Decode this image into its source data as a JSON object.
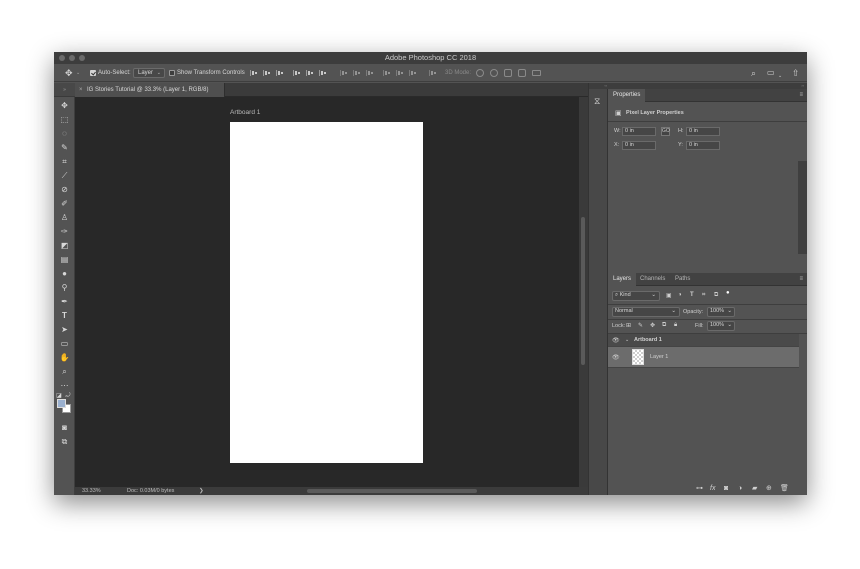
{
  "window": {
    "title": "Adobe Photoshop CC 2018"
  },
  "options_bar": {
    "auto_select_label": "Auto-Select:",
    "auto_select_target": "Layer",
    "show_transform_label": "Show Transform Controls",
    "mode_3d_label": "3D Mode:"
  },
  "document": {
    "tab_title": "IG Stories Tutorial @ 33.3% (Layer 1, RGB/8)",
    "artboard_label": "Artboard 1"
  },
  "status_bar": {
    "zoom": "33.33%",
    "doc_size": "Doc: 0.03M/0 bytes",
    "arrow": "❯"
  },
  "properties_panel": {
    "tab": "Properties",
    "section_title": "Pixel Layer Properties",
    "fields": {
      "w_label": "W:",
      "w_value": "0 in",
      "link_label": "GO",
      "h_label": "H:",
      "h_value": "0 in",
      "x_label": "X:",
      "x_value": "0 in",
      "y_label": "Y:",
      "y_value": "0 in"
    }
  },
  "layers_panel": {
    "tabs": [
      "Layers",
      "Channels",
      "Paths"
    ],
    "filter_label": "Kind",
    "blend_mode": "Normal",
    "opacity_label": "Opacity:",
    "opacity_value": "100%",
    "lock_label": "Lock:",
    "fill_label": "Fill:",
    "fill_value": "100%",
    "artboard_name": "Artboard 1",
    "layer_name": "Layer 1",
    "footer_fx": "fx"
  },
  "icons": {
    "move_tool": "move-icon",
    "search": "search-icon",
    "workspace": "workspace-icon",
    "share": "share-icon"
  },
  "colors": {
    "foreground": "#9ab0cf",
    "background": "#ffffff",
    "canvas_bg": "#282828",
    "ui_gray": "#535353"
  }
}
